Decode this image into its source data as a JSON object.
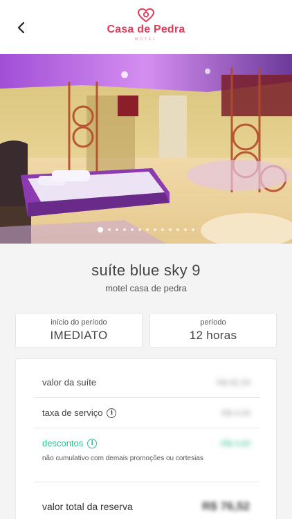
{
  "header": {
    "logo_title": "Casa de Pedra",
    "logo_subtitle": "MOTEL",
    "brand_color": "#e03a5a"
  },
  "gallery": {
    "image_count": 13,
    "active_index": 0
  },
  "suite": {
    "name": "suíte blue sky 9",
    "motel": "motel casa de pedra"
  },
  "booking": {
    "start_label": "início do período",
    "start_value": "IMEDIATO",
    "period_label": "período",
    "period_value": "12 horas"
  },
  "pricing": {
    "suite_value_label": "valor da suíte",
    "suite_value_amount": "R$ 82,00",
    "service_fee_label": "taxa de serviço",
    "service_fee_amount": "R$ 4,00",
    "discount_label": "descontos",
    "discount_amount": "-R$ 4,00",
    "discount_note": "não cumulativo com demais promoções ou cortesias",
    "total_label": "valor total da reserva",
    "total_amount": "R$ 76,52",
    "accent_color": "#2dbd8e"
  }
}
